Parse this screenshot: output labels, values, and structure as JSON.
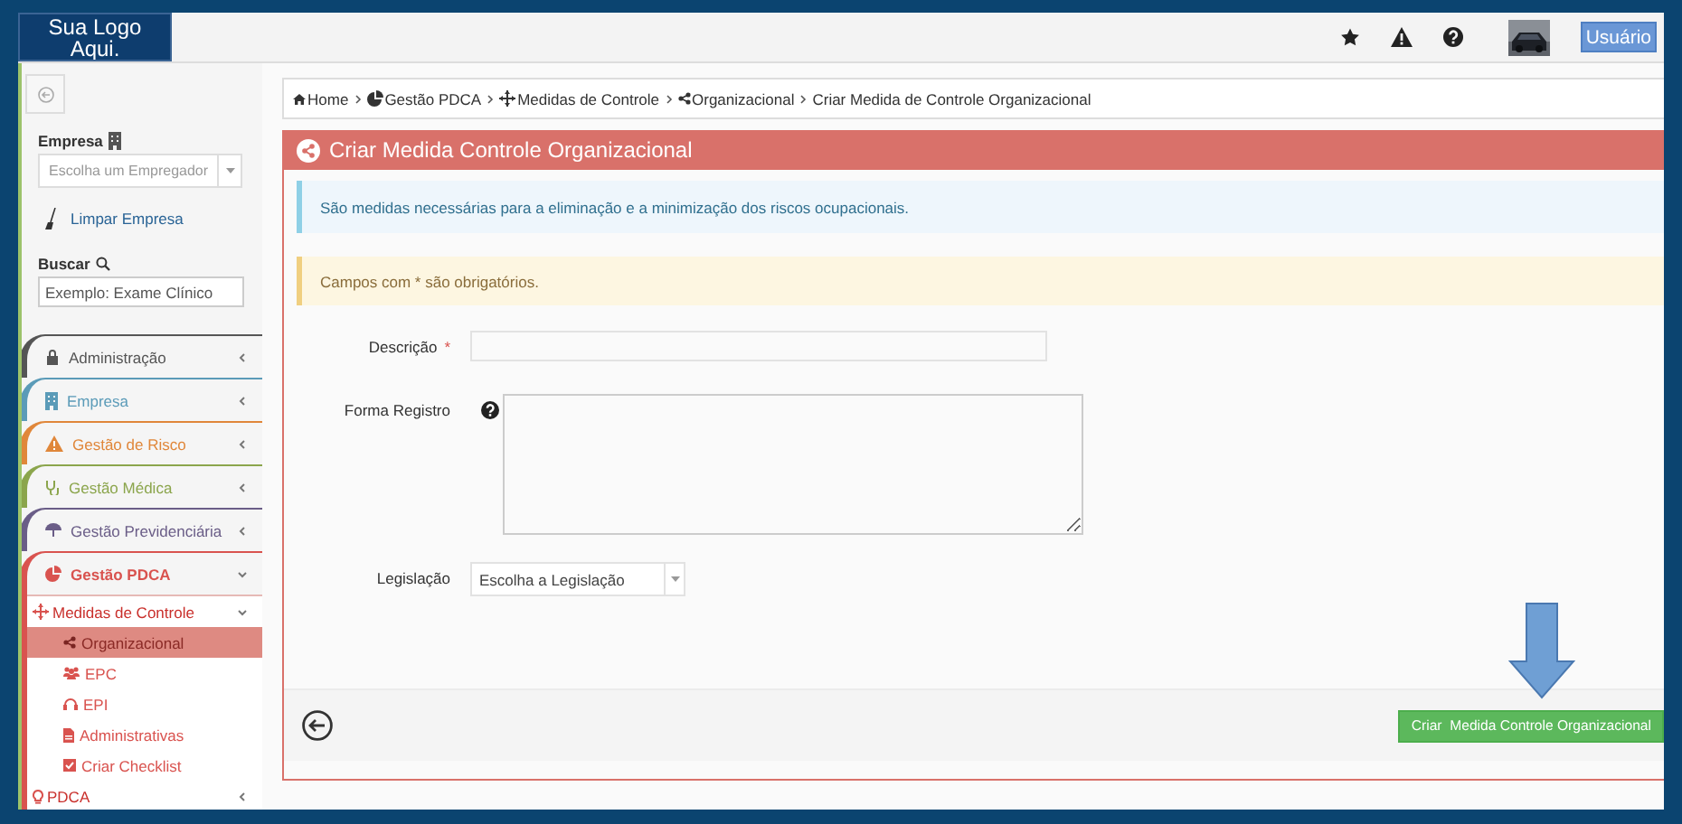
{
  "topbar": {
    "logo": "Sua Logo Aqui.",
    "user_button": "Usuário"
  },
  "sidebar": {
    "company_label": "Empresa",
    "company_select": {
      "placeholder": "Escolha um Empregador"
    },
    "clear_link": "Limpar Empresa",
    "search_label": "Buscar",
    "search": {
      "placeholder": "Exemplo: Exame Clínico"
    },
    "menu": [
      {
        "label": "Administração",
        "color": "#555555",
        "expanded": false
      },
      {
        "label": "Empresa",
        "color": "#5b9bb8",
        "expanded": false
      },
      {
        "label": "Gestão de Risco",
        "color": "#e0873a",
        "expanded": false
      },
      {
        "label": "Gestão Médica",
        "color": "#8ba54c",
        "expanded": false
      },
      {
        "label": "Gestão Previdenciária",
        "color": "#6a5d87",
        "expanded": false
      },
      {
        "label": "Gestão PDCA",
        "color": "#d9534f",
        "expanded": true,
        "children": [
          {
            "label": "Medidas de Controle",
            "expanded": true,
            "children": [
              {
                "label": "Organizacional",
                "selected": true
              },
              {
                "label": "EPC",
                "selected": false
              },
              {
                "label": "EPI",
                "selected": false
              },
              {
                "label": "Administrativas",
                "selected": false
              },
              {
                "label": "Criar Checklist",
                "selected": false
              }
            ]
          },
          {
            "label": "PDCA",
            "expanded": false
          }
        ]
      }
    ]
  },
  "breadcrumb": [
    {
      "label": "Home"
    },
    {
      "label": "Gestão PDCA"
    },
    {
      "label": "Medidas de Controle"
    },
    {
      "label": "Organizacional"
    },
    {
      "label": "Criar Medida de Controle Organizacional"
    }
  ],
  "panel": {
    "title": "Criar Medida Controle Organizacional",
    "info": "São medidas necessárias para a eliminação e a minimização dos riscos ocupacionais.",
    "warning": "Campos com * são obrigatórios.",
    "fields": [
      {
        "kind": "text",
        "label": "Descrição",
        "required_mark": "*"
      },
      {
        "kind": "textarea",
        "label": "Forma Registro",
        "help": true
      },
      {
        "kind": "select",
        "label": "Legislação",
        "value": "Escolha a Legislação"
      }
    ],
    "submit": "Criar  Medida Controle Organizacional"
  }
}
